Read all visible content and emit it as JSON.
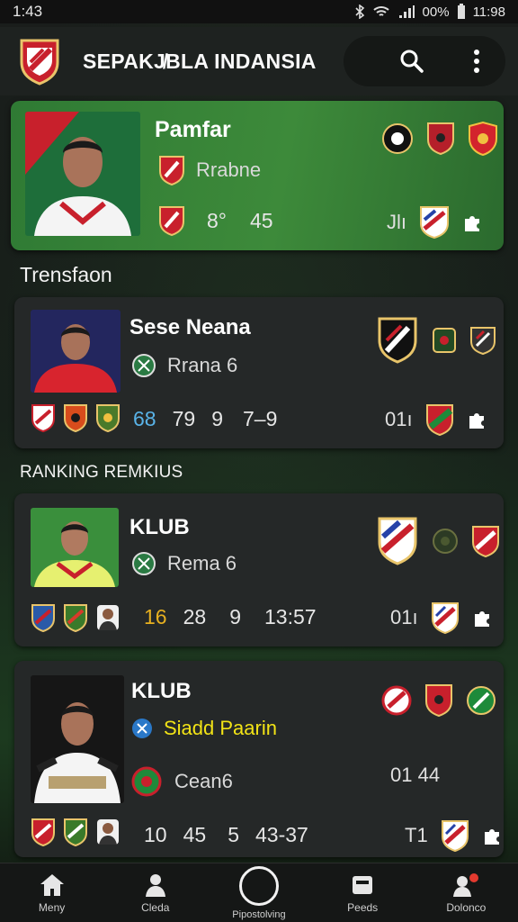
{
  "status": {
    "time": "1:43",
    "battery": "00%",
    "clock": "11:98"
  },
  "app": {
    "title": "SEPAKJ̸BLA INDANSIA"
  },
  "featured": {
    "name": "Pamfar",
    "club": "Rrabne",
    "stats": [
      "8°",
      "45"
    ],
    "tail_text": "Jlı"
  },
  "sections": [
    {
      "title": "Trensfaon"
    },
    {
      "title": "RANKING REMKIUS"
    }
  ],
  "cards": [
    {
      "name": "Sese Neana",
      "club": "Rrana 6",
      "stats": [
        "68",
        "79",
        "9",
        "7–9"
      ],
      "tail_text": "01ı"
    },
    {
      "name": "KLUB",
      "club": "Rema 6",
      "stats": [
        "16",
        "28",
        "9",
        "13:57"
      ],
      "tail_text": "01ı"
    },
    {
      "name": "KLUB",
      "club": "Siadd Paarin",
      "club2": "Cean6",
      "stats": [
        "10",
        "45",
        "5",
        "43-37"
      ],
      "tail_text": "01 44",
      "tail_text2": "T1"
    }
  ],
  "nav": [
    {
      "label": "Meny"
    },
    {
      "label": "Cleda"
    },
    {
      "label": "Pipostolving"
    },
    {
      "label": "Peeds"
    },
    {
      "label": "Dolonco"
    }
  ],
  "colors": {
    "accent_green": "#3a8a38",
    "gold_stat": "#e7b020",
    "blue_stat": "#59b3e8",
    "sponsor_yellow": "#f2e316"
  },
  "icons": {
    "search": "search-icon",
    "more": "more-vertical-icon"
  }
}
